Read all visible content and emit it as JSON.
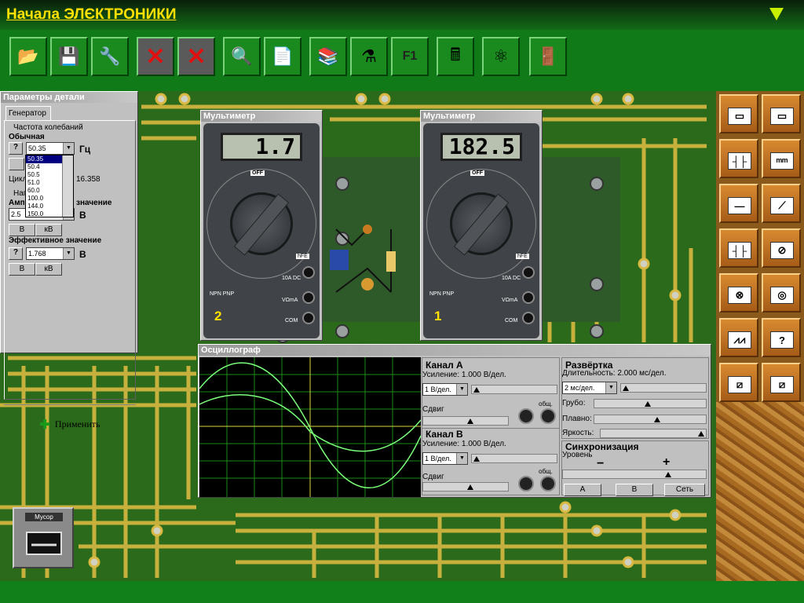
{
  "app": {
    "title": "Начала ЭЛЄКТРОНИКИ"
  },
  "toolbar": {
    "icons": [
      "open-icon",
      "save-icon",
      "tools-icon",
      "delete-icon",
      "clear-icon",
      "magnify-icon",
      "notes-icon",
      "books-icon",
      "lab-icon",
      "help-f1-icon",
      "calculator-icon",
      "molecule-icon",
      "exit-door-icon"
    ]
  },
  "params": {
    "title": "Параметры детали",
    "tab": "Генератор",
    "freq_group": "Частота колебаний",
    "mode": "Обычная",
    "freq_value": "50.35",
    "freq_unit": "Гц",
    "cycle_label": "Цикл",
    "cycle_value": "16.358",
    "amp_group": "Наг",
    "amp_label": "Амп",
    "amp_label_tail": "значение",
    "amp_value": "2.5",
    "amp_unit": "В",
    "unit_v": "В",
    "unit_kv": "кВ",
    "eff_label": "Эффективное значение",
    "eff_value": "1.768",
    "eff_unit": "В",
    "dropdown": [
      "50.35",
      "50.4",
      "50.5",
      "51.0",
      "60.0",
      "100.0",
      "144.0",
      "150.0"
    ],
    "apply": "Применить",
    "q": "?"
  },
  "mm1": {
    "title": "Мультиметр",
    "display": "1.7",
    "number": "2",
    "off": "OFF",
    "hfe": "hFE",
    "com": "COM",
    "vomega": "VΩmA",
    "npn": "NPN PNP",
    "hours": "10A DC"
  },
  "mm2": {
    "title": "Мультиметр",
    "display": "182.5",
    "number": "1",
    "off": "OFF",
    "hfe": "hFE",
    "com": "COM",
    "vomega": "VΩmA",
    "npn": "NPN PNP",
    "hours": "10A DC"
  },
  "osc": {
    "title": "Осциллограф",
    "chA": {
      "title": "Канал А",
      "gain": "Усиление:  1.000 В/дел.",
      "sel": "1 В/дел.",
      "shift": "Сдвиг",
      "common": "общ."
    },
    "chB": {
      "title": "Канал В",
      "gain": "Усиление:  1.000 В/дел.",
      "sel": "1 В/дел.",
      "shift": "Сдвиг",
      "common": "общ."
    },
    "sweep": {
      "title": "Развёртка",
      "duration": "Длительность:  2.000 мс/дел.",
      "sel": "2 мс/дел.",
      "coarse": "Грубо:",
      "fine": "Плавно:",
      "brightness": "Яркость:"
    },
    "sync": {
      "title": "Синхронизация",
      "level": "Уровень",
      "minus": "−",
      "plus": "+",
      "btnA": "A",
      "btnB": "B",
      "btnNet": "Сеть"
    }
  },
  "trash": {
    "label": "Мусор"
  },
  "parts": [
    "resistor-icon",
    "fuse-icon",
    "capacitor-icon",
    "inductor-icon",
    "wire-icon",
    "switch-icon",
    "electrolytic-capacitor-icon",
    "meter-icon",
    "lamp-icon",
    "coil-icon",
    "ac-resistor-icon",
    "unknown-part-icon",
    "variable-resistor-icon",
    "variable-resistor-2-icon"
  ],
  "parts_q": "?",
  "colors": {
    "accent": "#ffe000",
    "board": "#2a6a1a",
    "trace": "#d8b840",
    "scope_grid": "#1a8a1a",
    "scope_wave": "#7aff7a"
  }
}
